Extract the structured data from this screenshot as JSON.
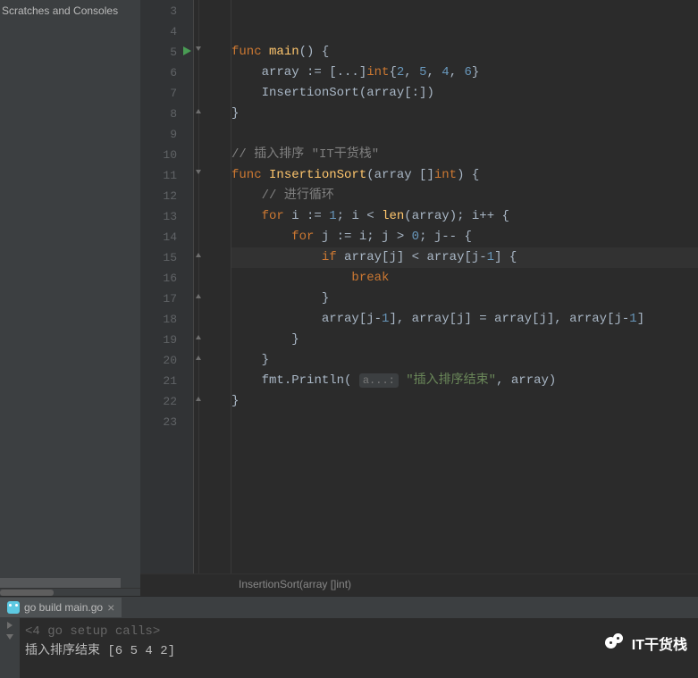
{
  "sidebar": {
    "label": "Scratches and Consoles"
  },
  "lines": {
    "start": 3,
    "run_marker_line": 5,
    "highlight_line": 15
  },
  "code": {
    "l5_func": "func",
    "l5_main": "main",
    "l6_array": "array",
    "l6_int": "int",
    "l6_v1": "2",
    "l6_v2": "5",
    "l6_v3": "4",
    "l6_v4": "6",
    "l7_call": "InsertionSort",
    "l10_cm": "// 插入排序 \"IT干货栈\"",
    "l11_func": "func",
    "l11_name": "InsertionSort",
    "l11_int": "int",
    "l12_cm": "// 进行循环",
    "l13_for": "for",
    "l13_one": "1",
    "l13_len": "len",
    "l14_for": "for",
    "l14_zero": "0",
    "l15_if": "if",
    "l15_one": "1",
    "l16_break": "break",
    "l18_one1": "1",
    "l18_one2": "1",
    "l21_fmt": "fmt",
    "l21_pl": "Println",
    "l21_hint": "a...:",
    "l21_str": "\"插入排序结束\""
  },
  "crumb": "InsertionSort(array []int)",
  "run_tab": {
    "label": "go build main.go"
  },
  "console": {
    "setup": "<4 go setup calls>",
    "output": "插入排序结束 [6 5 4 2]"
  },
  "watermark": "IT干货栈"
}
